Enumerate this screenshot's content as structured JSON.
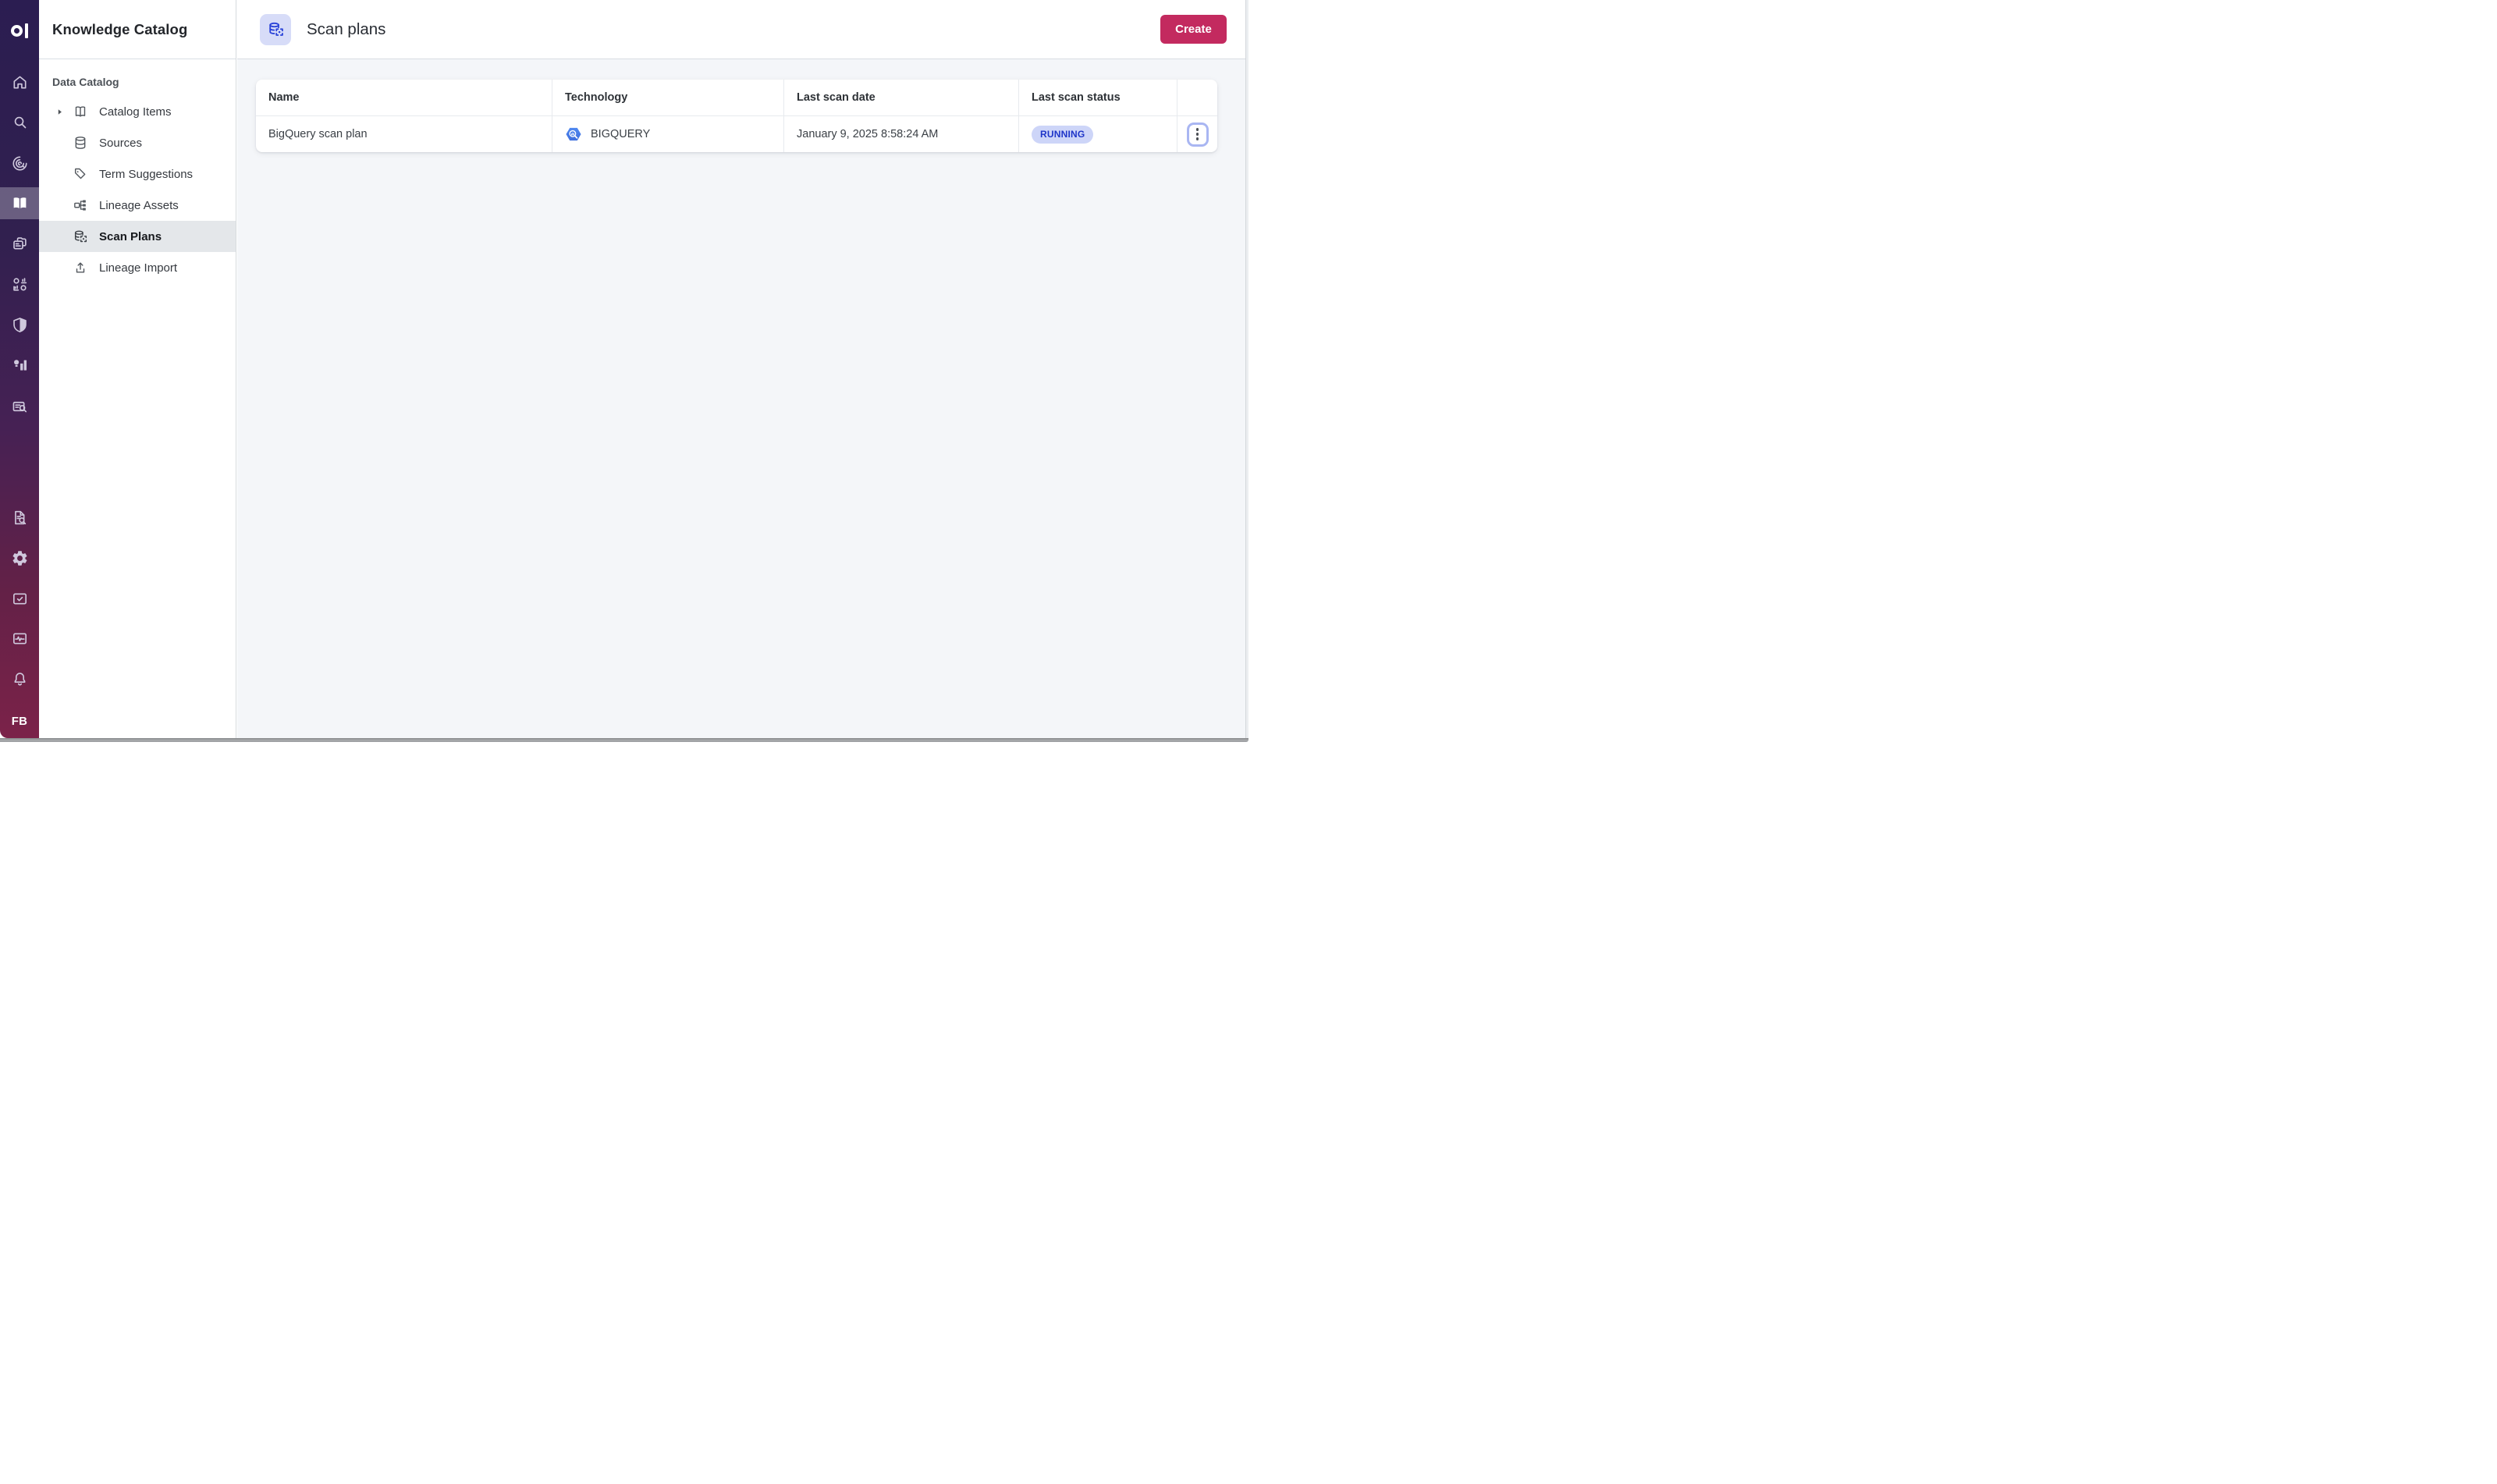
{
  "rail": {
    "logo_icon": "ataccama-one-logo-icon",
    "items": [
      {
        "icon": "home-icon"
      },
      {
        "icon": "search-icon"
      },
      {
        "icon": "data-quality-icon"
      },
      {
        "icon": "knowledge-catalog-book-icon",
        "selected": true
      },
      {
        "icon": "documents-icon"
      },
      {
        "icon": "master-data-icon"
      },
      {
        "icon": "shield-icon"
      },
      {
        "icon": "insights-chart-icon"
      },
      {
        "icon": "data-stories-icon"
      },
      {
        "icon": "audit-document-icon"
      },
      {
        "icon": "gear-icon"
      },
      {
        "icon": "tasks-icon"
      },
      {
        "icon": "monitoring-icon"
      },
      {
        "icon": "bell-icon"
      }
    ],
    "user_initials": "FB"
  },
  "sidebar": {
    "title": "Knowledge Catalog",
    "section_label": "Data Catalog",
    "items": [
      {
        "label": "Catalog Items",
        "icon": "book-open-icon",
        "expandable": true
      },
      {
        "label": "Sources",
        "icon": "database-icon"
      },
      {
        "label": "Term Suggestions",
        "icon": "tag-icon"
      },
      {
        "label": "Lineage Assets",
        "icon": "lineage-icon"
      },
      {
        "label": "Scan Plans",
        "icon": "scan-plan-icon",
        "selected": true
      },
      {
        "label": "Lineage Import",
        "icon": "upload-icon"
      }
    ]
  },
  "header": {
    "icon": "scan-plan-icon",
    "title": "Scan plans",
    "create_label": "Create"
  },
  "table": {
    "columns": [
      "Name",
      "Technology",
      "Last scan date",
      "Last scan status"
    ],
    "rows": [
      {
        "name": "BigQuery scan plan",
        "technology": "BIGQUERY",
        "technology_icon": "bigquery-icon",
        "last_scan_date": "January 9, 2025 8:58:24 AM",
        "last_scan_status": "RUNNING"
      }
    ]
  },
  "colors": {
    "accent_create": "#c32a5f",
    "rail_gradient_top": "#2b1d51",
    "rail_gradient_bottom": "#7b2249",
    "badge_bg": "#cdd5f8",
    "badge_text": "#1e35c8",
    "title_chip_bg": "#d7dcf8",
    "title_chip_icon": "#2942d8",
    "bigquery_blue": "#4983ef",
    "content_bg": "#f4f6f9"
  }
}
